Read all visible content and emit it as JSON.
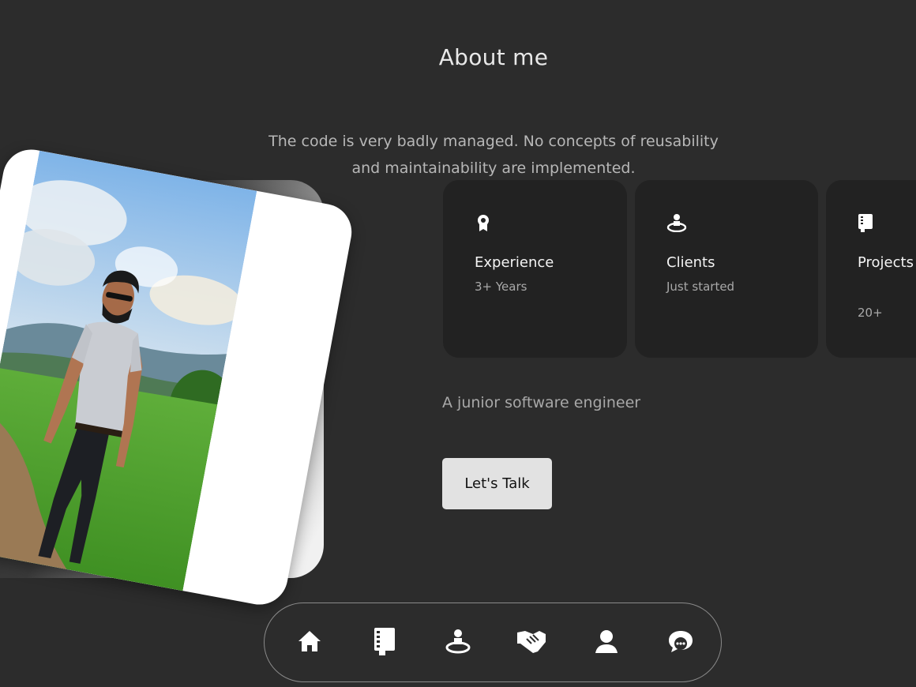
{
  "about": {
    "title": "About me",
    "intro": "The code is very badly managed. No concepts of reusability and maintainability are implemented.",
    "tagline": "A junior software engineer",
    "cta_label": "Let's Talk"
  },
  "stats": [
    {
      "icon": "award-icon",
      "label": "Experience",
      "value": "3+ Years"
    },
    {
      "icon": "user-podium-icon",
      "label": "Clients",
      "value": "Just started"
    },
    {
      "icon": "book-icon",
      "label": "Projects Completed",
      "value": "20+"
    }
  ],
  "nav": {
    "items": [
      {
        "icon": "home-icon",
        "name": "nav-home"
      },
      {
        "icon": "book-icon",
        "name": "nav-about"
      },
      {
        "icon": "user-podium-icon",
        "name": "nav-experience"
      },
      {
        "icon": "handshake-icon",
        "name": "nav-services"
      },
      {
        "icon": "user-icon",
        "name": "nav-portfolio"
      },
      {
        "icon": "chat-icon",
        "name": "nav-contact"
      }
    ]
  },
  "colors": {
    "background": "#2c2c2c",
    "card": "#222222",
    "button": "#e2e2e2",
    "text_primary": "#e8e8e8",
    "text_muted": "#a8a8a8"
  }
}
